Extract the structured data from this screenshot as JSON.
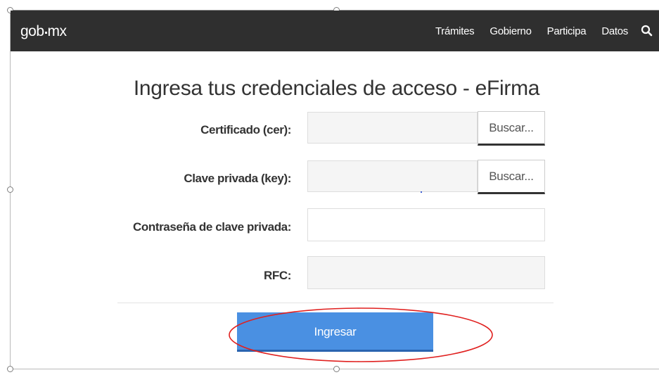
{
  "navbar": {
    "logo": {
      "part1": "gob",
      "part2": "mx"
    },
    "items": [
      "Trámites",
      "Gobierno",
      "Participa",
      "Datos"
    ],
    "search_icon": "search-icon"
  },
  "form": {
    "title": "Ingresa tus credenciales de acceso - eFirma",
    "certificate_label": "Certificado (cer):",
    "certificate_value": "",
    "certificate_button": "Buscar...",
    "private_key_label": "Clave privada (key):",
    "private_key_value": "",
    "private_key_button": "Buscar...",
    "password_label": "Contraseña de clave privada:",
    "password_value": "",
    "rfc_label": "RFC:",
    "rfc_value": "",
    "submit_label": "Ingresar"
  },
  "colors": {
    "navbar_bg": "#2f2f2f",
    "submit_bg": "#4a90e2",
    "annotation": "#e0201f"
  }
}
